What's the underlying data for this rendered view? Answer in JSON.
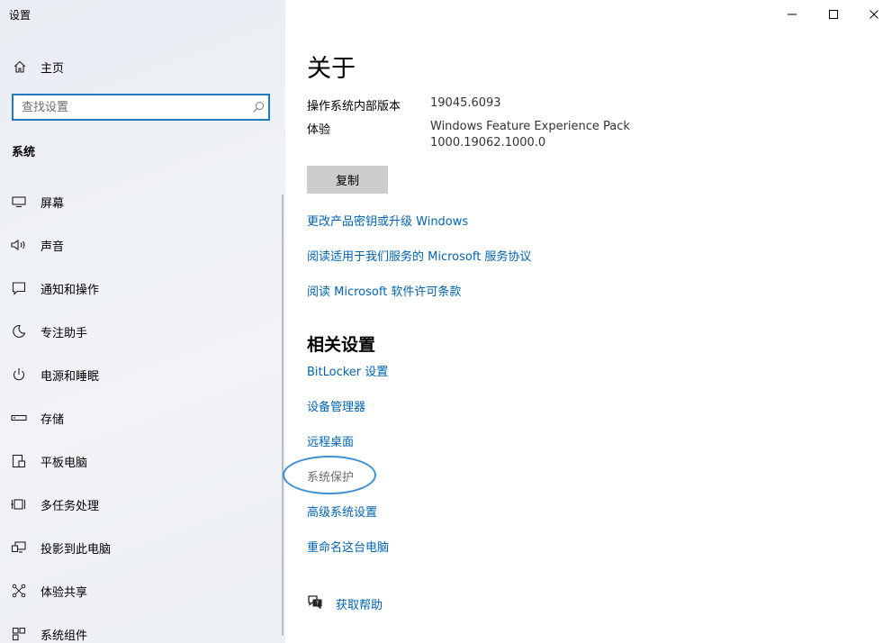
{
  "window": {
    "title": "设置"
  },
  "sidebar": {
    "home_label": "主页",
    "search_placeholder": "查找设置",
    "section_title": "系统",
    "items": [
      {
        "label": "屏幕",
        "icon": "monitor-icon"
      },
      {
        "label": "声音",
        "icon": "speaker-icon"
      },
      {
        "label": "通知和操作",
        "icon": "notification-icon"
      },
      {
        "label": "专注助手",
        "icon": "moon-icon"
      },
      {
        "label": "电源和睡眠",
        "icon": "power-icon"
      },
      {
        "label": "存储",
        "icon": "storage-icon"
      },
      {
        "label": "平板电脑",
        "icon": "tablet-icon"
      },
      {
        "label": "多任务处理",
        "icon": "multitask-icon"
      },
      {
        "label": "投影到此电脑",
        "icon": "project-icon"
      },
      {
        "label": "体验共享",
        "icon": "share-icon"
      },
      {
        "label": "系统组件",
        "icon": "components-icon"
      }
    ]
  },
  "main": {
    "title": "关于",
    "specs": [
      {
        "label": "操作系统内部版本",
        "value": "19045.6093"
      },
      {
        "label": "体验",
        "value": "Windows Feature Experience Pack",
        "value2": "1000.19062.1000.0"
      }
    ],
    "copy_label": "复制",
    "links": [
      "更改产品密钥或升级 Windows",
      "阅读适用于我们服务的 Microsoft 服务协议",
      "阅读 Microsoft 软件许可条款"
    ],
    "related_title": "相关设置",
    "related_links": [
      "BitLocker 设置",
      "设备管理器",
      "远程桌面",
      "系统保护",
      "高级系统设置",
      "重命名这台电脑"
    ],
    "help_label": "获取帮助"
  },
  "colors": {
    "link": "#0063b1",
    "accent": "#1f7ac4",
    "highlight_oval": "#3b8fd4"
  }
}
